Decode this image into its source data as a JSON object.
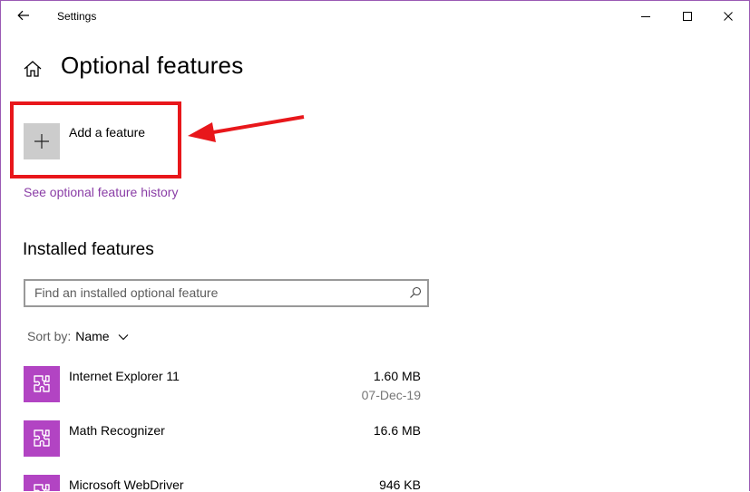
{
  "titlebar": {
    "title": "Settings",
    "back_icon": "arrow-left-icon",
    "minimize_icon": "minimize-icon",
    "maximize_icon": "maximize-icon",
    "close_icon": "close-icon"
  },
  "header": {
    "home_icon": "home-icon",
    "title": "Optional features"
  },
  "add_feature": {
    "label": "Add a feature",
    "icon": "plus-icon"
  },
  "history_link": "See optional feature history",
  "installed": {
    "title": "Installed features",
    "search_placeholder": "Find an installed optional feature",
    "search_value": "",
    "sort_label": "Sort by:",
    "sort_value": "Name",
    "items": [
      {
        "name": "Internet Explorer 11",
        "size": "1.60 MB",
        "date": "07-Dec-19",
        "icon": "puzzle-piece-icon"
      },
      {
        "name": "Math Recognizer",
        "size": "16.6 MB",
        "date": "",
        "icon": "puzzle-piece-icon"
      },
      {
        "name": "Microsoft WebDriver",
        "size": "946 KB",
        "date": "",
        "icon": "puzzle-piece-icon"
      }
    ]
  },
  "colors": {
    "accent": "#b244c3",
    "link": "#8a3da6",
    "annotation_red": "#e8171b",
    "window_border": "#9a59b4",
    "add_tile": "#cccccc"
  }
}
